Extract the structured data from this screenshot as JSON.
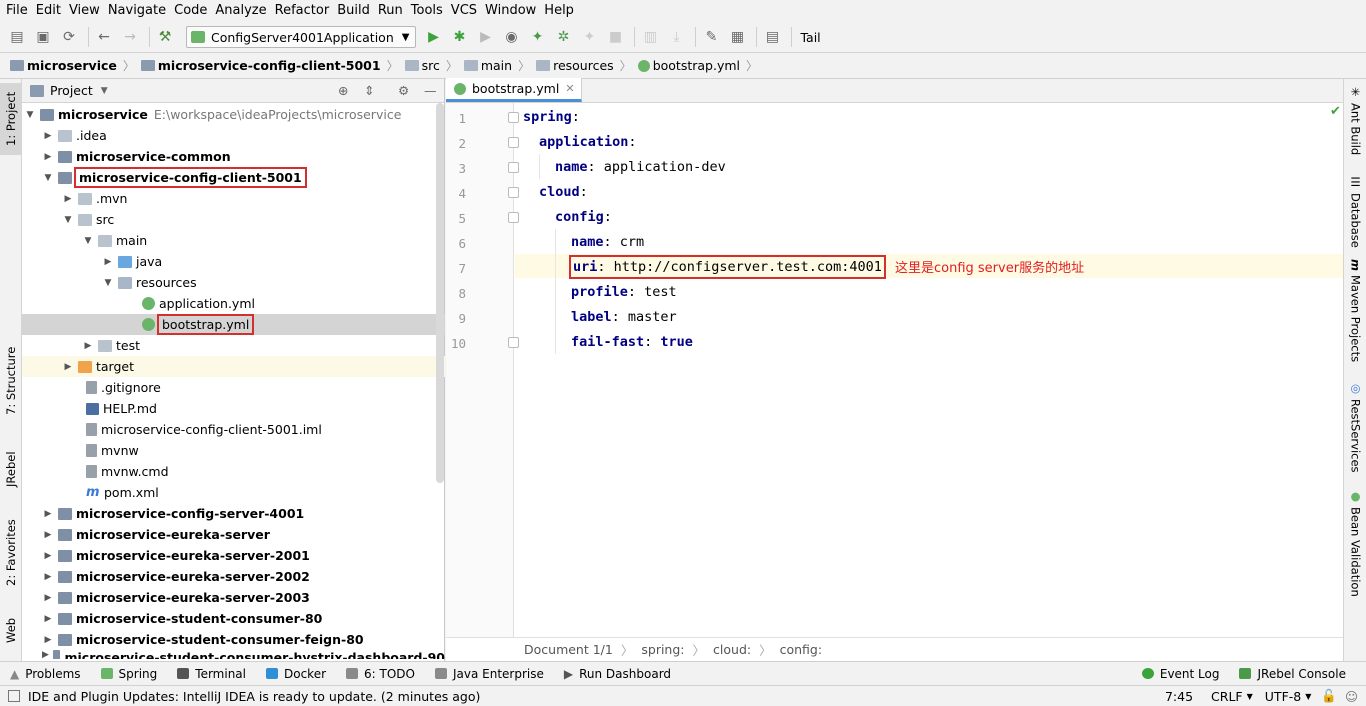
{
  "menu": [
    "File",
    "Edit",
    "View",
    "Navigate",
    "Code",
    "Analyze",
    "Refactor",
    "Build",
    "Run",
    "Tools",
    "VCS",
    "Window",
    "Help"
  ],
  "toolbar": {
    "run_config": "ConfigServer4001Application",
    "tail_label": "Tail"
  },
  "breadcrumbs": [
    "microservice",
    "microservice-config-client-5001",
    "src",
    "main",
    "resources",
    "bootstrap.yml"
  ],
  "left_tabs": {
    "project": "1: Project",
    "structure": "7: Structure",
    "jrebel": "JRebel",
    "favorites": "2: Favorites",
    "web": "Web"
  },
  "right_tabs": {
    "ant": "Ant Build",
    "database": "Database",
    "maven": "Maven Projects",
    "rest": "RestServices",
    "bean": "Bean Validation"
  },
  "project_panel": {
    "title": "Project"
  },
  "tree": [
    {
      "label": "microservice",
      "path": "E:\\workspace\\ideaProjects\\microservice"
    },
    {
      "label": ".idea"
    },
    {
      "label": "microservice-common"
    },
    {
      "label": "microservice-config-client-5001"
    },
    {
      "label": ".mvn"
    },
    {
      "label": "src"
    },
    {
      "label": "main"
    },
    {
      "label": "java"
    },
    {
      "label": "resources"
    },
    {
      "label": "application.yml"
    },
    {
      "label": "bootstrap.yml"
    },
    {
      "label": "test"
    },
    {
      "label": "target"
    },
    {
      "label": ".gitignore"
    },
    {
      "label": "HELP.md"
    },
    {
      "label": "microservice-config-client-5001.iml"
    },
    {
      "label": "mvnw"
    },
    {
      "label": "mvnw.cmd"
    },
    {
      "label": "pom.xml"
    },
    {
      "label": "microservice-config-server-4001"
    },
    {
      "label": "microservice-eureka-server"
    },
    {
      "label": "microservice-eureka-server-2001"
    },
    {
      "label": "microservice-eureka-server-2002"
    },
    {
      "label": "microservice-eureka-server-2003"
    },
    {
      "label": "microservice-student-consumer-80"
    },
    {
      "label": "microservice-student-consumer-feign-80"
    },
    {
      "label": "microservice-student-consumer-hystrix-dashboard-90"
    }
  ],
  "editor": {
    "tab": "bootstrap.yml",
    "lines": [
      {
        "n": "1",
        "key": "spring",
        "sep": ":",
        "val": ""
      },
      {
        "n": "2",
        "key": "application",
        "sep": ":",
        "val": ""
      },
      {
        "n": "3",
        "key": "name",
        "sep": ": ",
        "val": "application-dev"
      },
      {
        "n": "4",
        "key": "cloud",
        "sep": ":",
        "val": ""
      },
      {
        "n": "5",
        "key": "config",
        "sep": ":",
        "val": ""
      },
      {
        "n": "6",
        "key": "name",
        "sep": ": ",
        "val": "crm"
      },
      {
        "n": "7",
        "key": "uri",
        "sep": ": ",
        "val": "http://configserver.test.com:4001"
      },
      {
        "n": "8",
        "key": "profile",
        "sep": ": ",
        "val": "test"
      },
      {
        "n": "9",
        "key": "label",
        "sep": ": ",
        "val": "master"
      },
      {
        "n": "10",
        "key": "fail-fast",
        "sep": ": ",
        "val": "true"
      }
    ],
    "annotation": "这里是config server服务的地址",
    "status": {
      "document": "Document 1/1",
      "path": [
        "spring:",
        "cloud:",
        "config:"
      ]
    }
  },
  "bottom_tabs": [
    "Problems",
    "Spring",
    "Terminal",
    "Docker",
    "6: TODO",
    "Java Enterprise",
    "Run Dashboard",
    "Event Log",
    "JRebel Console"
  ],
  "statusbar": {
    "message": "IDE and Plugin Updates: IntelliJ IDEA is ready to update. (2 minutes ago)",
    "position": "7:45",
    "line_sep": "CRLF",
    "encoding": "UTF-8"
  }
}
